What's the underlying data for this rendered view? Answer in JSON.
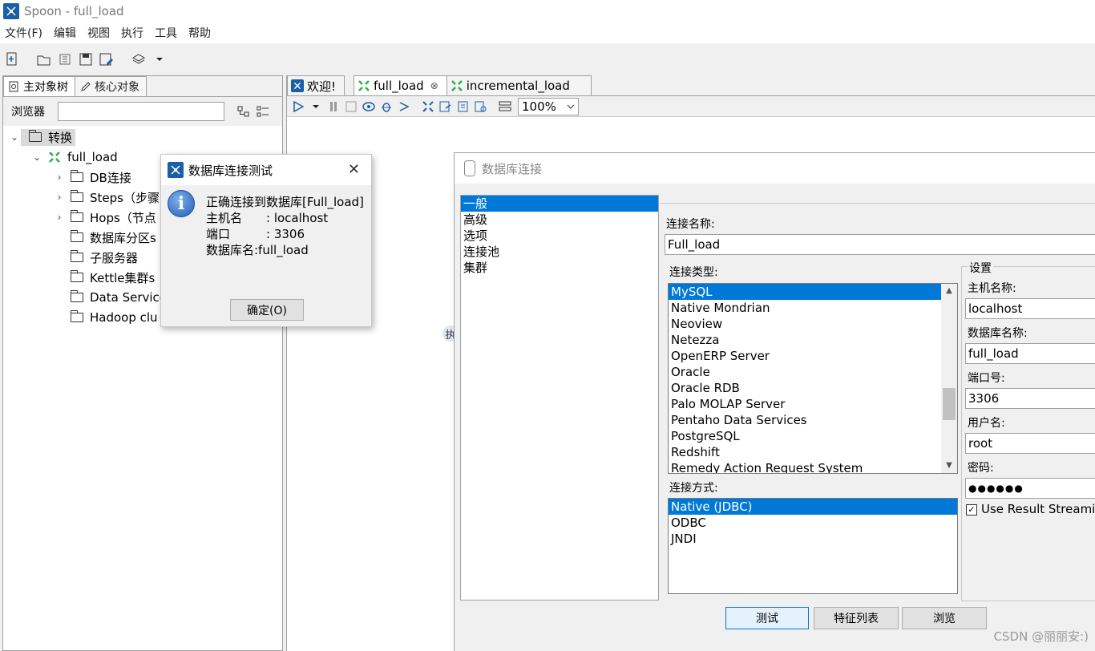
{
  "app": {
    "title": "Spoon - full_load"
  },
  "menu": [
    "文件(F)",
    "编辑",
    "视图",
    "执行",
    "工具",
    "帮助"
  ],
  "left_panel": {
    "tabs": [
      "主对象树",
      "核心对象"
    ],
    "search_label": "浏览器",
    "tree": {
      "root": "转换",
      "transformation": "full_load",
      "children": [
        "DB连接",
        "Steps（步骤",
        "Hops（节点",
        "数据库分区s",
        "子服务器",
        "Kettle集群s",
        "Data Service",
        "Hadoop clu"
      ]
    }
  },
  "editor": {
    "tabs": [
      "欢迎!",
      "full_load",
      "incremental_load"
    ],
    "zoom": "100%",
    "canvas_node_text": "执"
  },
  "db_dialog": {
    "title": "数据库连接",
    "categories": [
      "一般",
      "高级",
      "选项",
      "连接池",
      "集群"
    ],
    "selected_category": "一般",
    "connection_name_label": "连接名称:",
    "connection_name": "Full_load",
    "connection_type_label": "连接类型:",
    "connection_types": [
      "MySQL",
      "Native Mondrian",
      "Neoview",
      "Netezza",
      "OpenERP Server",
      "Oracle",
      "Oracle RDB",
      "Palo MOLAP Server",
      "Pentaho Data Services",
      "PostgreSQL",
      "Redshift",
      "Remedy Action Request System"
    ],
    "selected_type": "MySQL",
    "access_label": "连接方式:",
    "access_methods": [
      "Native (JDBC)",
      "ODBC",
      "JNDI"
    ],
    "selected_access": "Native (JDBC)",
    "settings": {
      "group_label": "设置",
      "host_label": "主机名称:",
      "host": "localhost",
      "dbname_label": "数据库名称:",
      "dbname": "full_load",
      "port_label": "端口号:",
      "port": "3306",
      "user_label": "用户名:",
      "user": "root",
      "password_label": "密码:",
      "password_mask": "●●●●●●",
      "streaming_label": "Use Result Streamin"
    },
    "buttons": {
      "test": "测试",
      "features": "特征列表",
      "explore": "浏览"
    }
  },
  "test_dialog": {
    "title": "数据库连接测试",
    "lines": [
      "正确连接到数据库[Full_load]",
      "主机名　　: localhost",
      "端口　　　: 3306",
      "数据库名:full_load"
    ],
    "ok_label": "确定(O)"
  },
  "watermark": "CSDN @丽丽安:)",
  "colors": {
    "selection": "#0078d7",
    "app_icon": "#1a5fa8",
    "kettle_green": "#2eae4e"
  }
}
